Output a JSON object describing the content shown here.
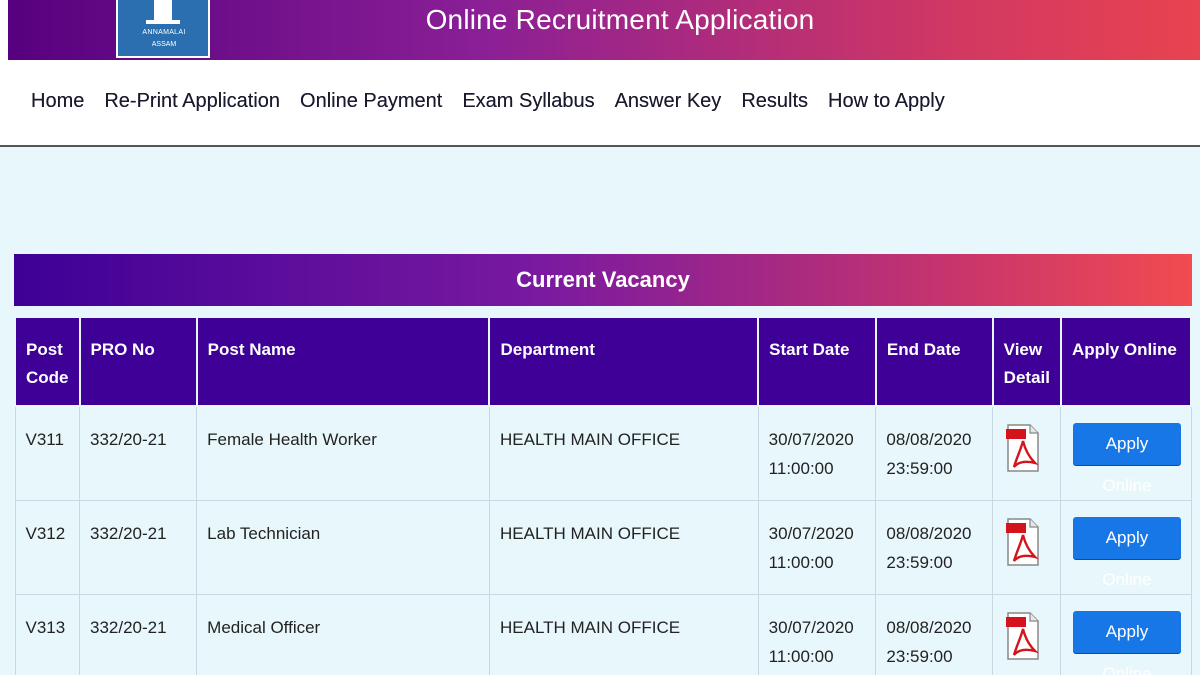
{
  "header": {
    "title": "Online Recruitment Application",
    "logo_text_line1": "ANNAMALAI",
    "logo_text_line2": "ASSAM",
    "logo_icon": "pillar-logo-icon",
    "gradient_start": "#56007f",
    "gradient_end": "#e8434f"
  },
  "nav": {
    "items": [
      {
        "label": "Home"
      },
      {
        "label": "Re-Print Application"
      },
      {
        "label": "Online Payment"
      },
      {
        "label": "Exam Syllabus"
      },
      {
        "label": "Answer Key"
      },
      {
        "label": "Results"
      },
      {
        "label": "How to Apply"
      }
    ]
  },
  "vacancy": {
    "title": "Current Vacancy",
    "columns": {
      "post_code": "Post Code",
      "pro_no": "PRO No",
      "post_name": "Post Name",
      "department": "Department",
      "start_date": "Start Date",
      "end_date": "End Date",
      "view_detail": "View Detail",
      "apply_online": "Apply Online"
    },
    "rows": [
      {
        "post_code": "V311",
        "pro_no": "332/20-21",
        "post_name": "Female Health Worker",
        "department": "HEALTH MAIN OFFICE",
        "start_date": "30/07/2020",
        "start_time": "11:00:00",
        "end_date": "08/08/2020",
        "end_time": "23:59:00",
        "detail_icon": "pdf-icon",
        "apply_label": "Apply Online"
      },
      {
        "post_code": "V312",
        "pro_no": "332/20-21",
        "post_name": "Lab Technician",
        "department": "HEALTH MAIN OFFICE",
        "start_date": "30/07/2020",
        "start_time": "11:00:00",
        "end_date": "08/08/2020",
        "end_time": "23:59:00",
        "detail_icon": "pdf-icon",
        "apply_label": "Apply Online"
      },
      {
        "post_code": "V313",
        "pro_no": "332/20-21",
        "post_name": "Medical Officer",
        "department": "HEALTH MAIN OFFICE",
        "start_date": "30/07/2020",
        "start_time": "11:00:00",
        "end_date": "08/08/2020",
        "end_time": "23:59:00",
        "detail_icon": "pdf-icon",
        "apply_label": "Apply Online"
      }
    ],
    "header_color": "#3e0096",
    "button_color": "#1877e6"
  }
}
